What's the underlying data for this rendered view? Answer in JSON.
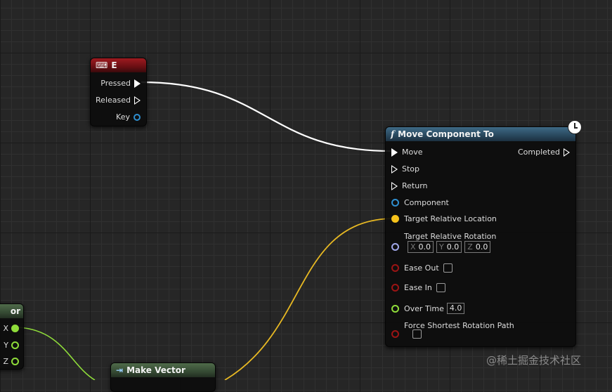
{
  "nodes": {
    "key_e": {
      "title": "E",
      "pins": {
        "pressed": "Pressed",
        "released": "Released",
        "key": "Key"
      }
    },
    "move_component": {
      "title": "Move Component To",
      "pins": {
        "move": "Move",
        "completed": "Completed",
        "stop": "Stop",
        "return": "Return",
        "component": "Component",
        "target_location": "Target Relative Location",
        "target_rotation": "Target Relative Rotation",
        "ease_out": "Ease Out",
        "ease_in": "Ease In",
        "over_time": "Over Time",
        "force_shortest": "Force Shortest Rotation Path"
      },
      "rotation": {
        "x_label": "X",
        "x_value": "0.0",
        "y_label": "Y",
        "y_value": "0.0",
        "z_label": "Z",
        "z_value": "0.0"
      },
      "over_time_value": "4.0",
      "ease_out_checked": false,
      "ease_in_checked": false,
      "force_shortest_checked": false
    },
    "break_vector": {
      "title_fragment": "or",
      "pins": {
        "x": "X",
        "y": "Y",
        "z": "Z"
      }
    },
    "make_vector": {
      "title": "Make Vector"
    }
  },
  "colors": {
    "exec": "#ffffff",
    "vector": "#f5c21b",
    "rotator": "#a0a7e8",
    "object": "#2f8fd0",
    "bool": "#9b1414",
    "float": "#8fdc3a",
    "struct": "#2f8fd0"
  },
  "icons": {
    "function": "function-icon",
    "key_event": "keyboard-icon",
    "make_vector": "make-struct-icon",
    "latent": "clock-icon"
  },
  "watermark": "@稀土掘金技术社区"
}
